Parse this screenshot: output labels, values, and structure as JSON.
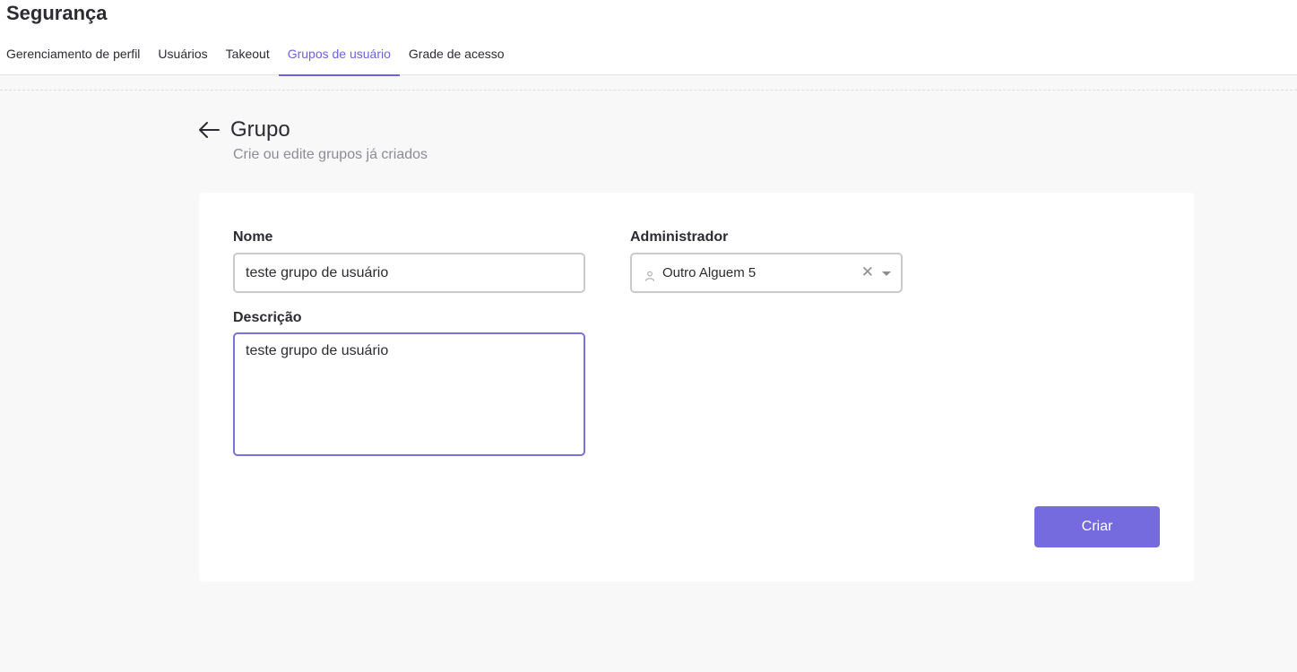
{
  "page": {
    "title": "Segurança"
  },
  "tabs": [
    {
      "label": "Gerenciamento de perfil",
      "active": false
    },
    {
      "label": "Usuários",
      "active": false
    },
    {
      "label": "Takeout",
      "active": false
    },
    {
      "label": "Grupos de usuário",
      "active": true
    },
    {
      "label": "Grade de acesso",
      "active": false
    }
  ],
  "header": {
    "back_icon": "arrow-left-icon",
    "title": "Grupo",
    "subtitle": "Crie ou edite grupos já criados"
  },
  "form": {
    "name": {
      "label": "Nome",
      "value": "teste grupo de usuário"
    },
    "description": {
      "label": "Descrição",
      "value": "teste grupo de usuário"
    },
    "admin": {
      "label": "Administrador",
      "value": "Outro Alguem 5",
      "icon": "user-icon",
      "clear_icon": "close-icon",
      "dropdown_icon": "caret-down-icon"
    },
    "submit_label": "Criar"
  },
  "colors": {
    "accent": "#6b63d9",
    "button": "#756bde",
    "background": "#f8f8f8",
    "card": "#ffffff"
  }
}
